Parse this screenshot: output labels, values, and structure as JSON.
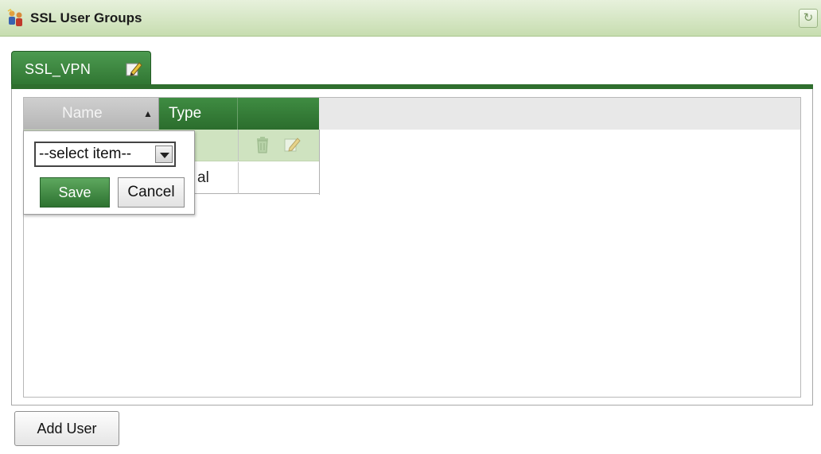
{
  "window": {
    "title": "SSL User Groups",
    "title_icon": "group-users-icon",
    "refresh_icon": "refresh-icon"
  },
  "tab": {
    "label": "SSL_VPN",
    "edit_icon": "edit-pencil-icon"
  },
  "grid": {
    "columns": [
      {
        "label": "Name",
        "sorted": "ascending"
      },
      {
        "label": "Type"
      },
      {
        "label": ""
      }
    ],
    "rows": [
      {
        "type_partial": "",
        "actions": [
          "trash-icon",
          "edit-pencil-icon"
        ],
        "highlighted": true
      },
      {
        "type_partial": "al",
        "actions": [],
        "highlighted": false
      }
    ]
  },
  "popup": {
    "select_value": "--select item--",
    "save_label": "Save",
    "cancel_label": "Cancel"
  },
  "footer": {
    "add_user_label": "Add User"
  },
  "colors": {
    "accent_green": "#2e7330",
    "titlebar_green": "#c7ddb0",
    "row_highlight": "#cfe3c0"
  }
}
